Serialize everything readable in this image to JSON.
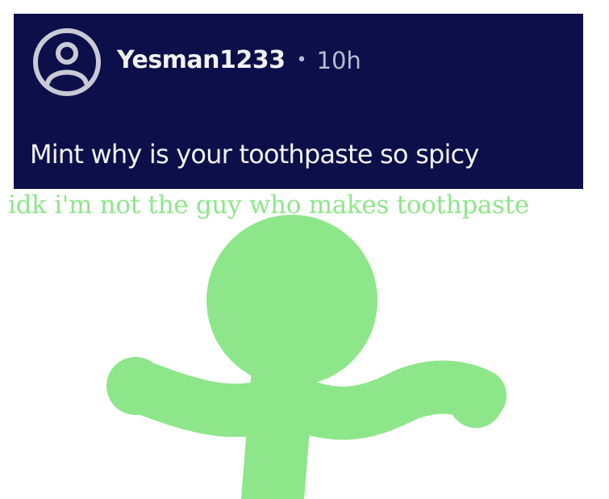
{
  "post": {
    "username": "Yesman1233",
    "separator": "•",
    "time": "10h",
    "body": "Mint why is your toothpaste so spicy",
    "card_color": "#0d0f4a",
    "avatar_icon": "user-circle-icon"
  },
  "reply": {
    "text": "idk i'm not the guy who makes toothpaste",
    "color": "#8ee68a"
  },
  "figure": {
    "icon": "shrugging-stick-figure",
    "color": "#8ee68a"
  }
}
